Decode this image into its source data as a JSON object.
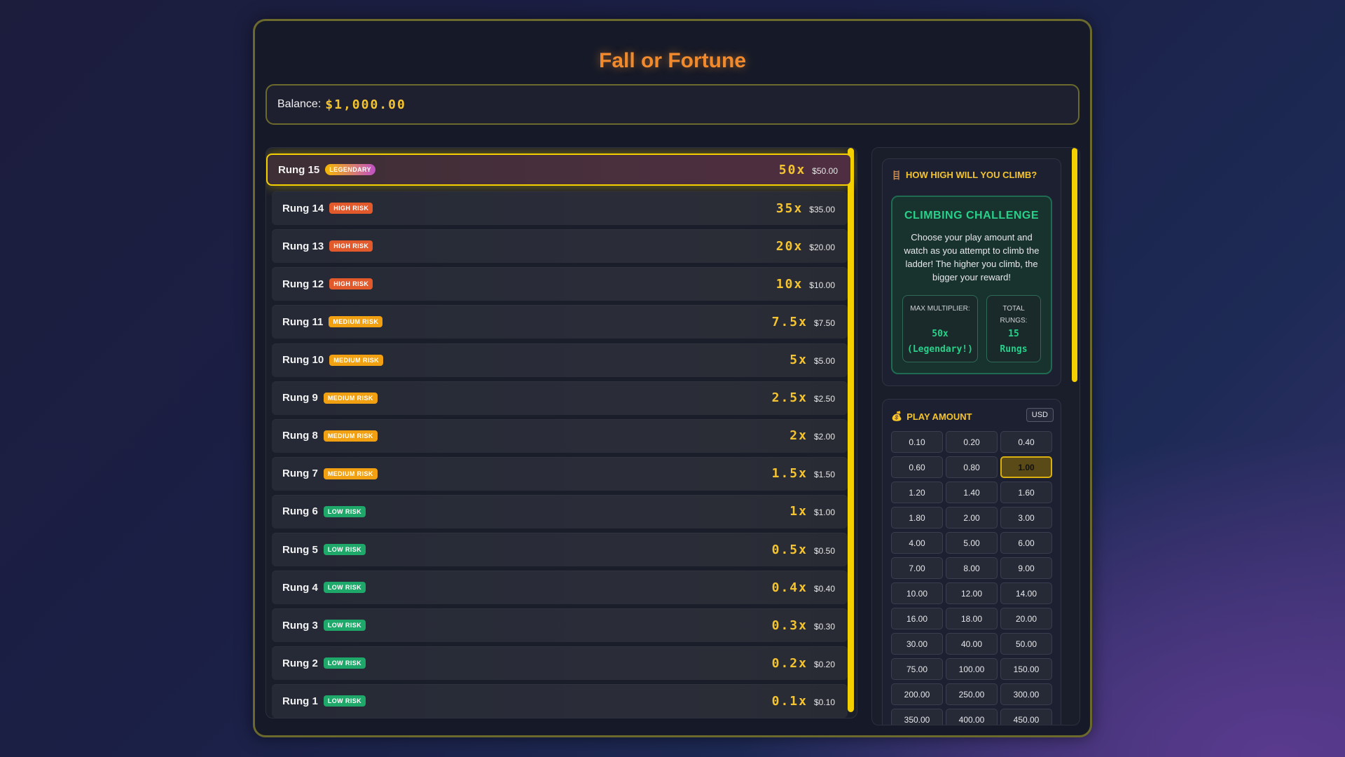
{
  "app": {
    "title": "Fall or Fortune"
  },
  "balance": {
    "label": "Balance:",
    "amount": "$1,000.00"
  },
  "rungs": [
    {
      "name": "Rung 15",
      "badge": "LEGENDARY",
      "risk": "legendary",
      "multiplier": "50x",
      "payout": "$50.00"
    },
    {
      "name": "Rung 14",
      "badge": "HIGH RISK",
      "risk": "high",
      "multiplier": "35x",
      "payout": "$35.00"
    },
    {
      "name": "Rung 13",
      "badge": "HIGH RISK",
      "risk": "high",
      "multiplier": "20x",
      "payout": "$20.00"
    },
    {
      "name": "Rung 12",
      "badge": "HIGH RISK",
      "risk": "high",
      "multiplier": "10x",
      "payout": "$10.00"
    },
    {
      "name": "Rung 11",
      "badge": "MEDIUM RISK",
      "risk": "medium",
      "multiplier": "7.5x",
      "payout": "$7.50"
    },
    {
      "name": "Rung 10",
      "badge": "MEDIUM RISK",
      "risk": "medium",
      "multiplier": "5x",
      "payout": "$5.00"
    },
    {
      "name": "Rung 9",
      "badge": "MEDIUM RISK",
      "risk": "medium",
      "multiplier": "2.5x",
      "payout": "$2.50"
    },
    {
      "name": "Rung 8",
      "badge": "MEDIUM RISK",
      "risk": "medium",
      "multiplier": "2x",
      "payout": "$2.00"
    },
    {
      "name": "Rung 7",
      "badge": "MEDIUM RISK",
      "risk": "medium",
      "multiplier": "1.5x",
      "payout": "$1.50"
    },
    {
      "name": "Rung 6",
      "badge": "LOW RISK",
      "risk": "low",
      "multiplier": "1x",
      "payout": "$1.00"
    },
    {
      "name": "Rung 5",
      "badge": "LOW RISK",
      "risk": "low",
      "multiplier": "0.5x",
      "payout": "$0.50"
    },
    {
      "name": "Rung 4",
      "badge": "LOW RISK",
      "risk": "low",
      "multiplier": "0.4x",
      "payout": "$0.40"
    },
    {
      "name": "Rung 3",
      "badge": "LOW RISK",
      "risk": "low",
      "multiplier": "0.3x",
      "payout": "$0.30"
    },
    {
      "name": "Rung 2",
      "badge": "LOW RISK",
      "risk": "low",
      "multiplier": "0.2x",
      "payout": "$0.20"
    },
    {
      "name": "Rung 1",
      "badge": "LOW RISK",
      "risk": "low",
      "multiplier": "0.1x",
      "payout": "$0.10"
    }
  ],
  "info": {
    "heading": "HOW HIGH WILL YOU CLIMB?",
    "heading_icon": "ladder-icon",
    "challenge_title": "CLIMBING CHALLENGE",
    "challenge_text": "Choose your play amount and watch as you attempt to climb the ladder! The higher you climb, the bigger your reward!",
    "max_label": "MAX MULTIPLIER:",
    "max_value_1": "50x",
    "max_value_2": "(Legendary!)",
    "total_label": "TOTAL RUNGS:",
    "total_value_1": "15",
    "total_value_2": "Rungs"
  },
  "play": {
    "heading": "PLAY AMOUNT",
    "heading_icon": "money-bag-icon",
    "currency": "USD",
    "selected": "1.00",
    "amounts": [
      "0.10",
      "0.20",
      "0.40",
      "0.60",
      "0.80",
      "1.00",
      "1.20",
      "1.40",
      "1.60",
      "1.80",
      "2.00",
      "3.00",
      "4.00",
      "5.00",
      "6.00",
      "7.00",
      "8.00",
      "9.00",
      "10.00",
      "12.00",
      "14.00",
      "16.00",
      "18.00",
      "20.00",
      "30.00",
      "40.00",
      "50.00",
      "75.00",
      "100.00",
      "150.00",
      "200.00",
      "250.00",
      "300.00",
      "350.00",
      "400.00",
      "450.00"
    ]
  },
  "colors": {
    "accent": "#f4c430",
    "title": "#f08a2c",
    "green": "#28d08a",
    "border": "#6b6a2c"
  }
}
